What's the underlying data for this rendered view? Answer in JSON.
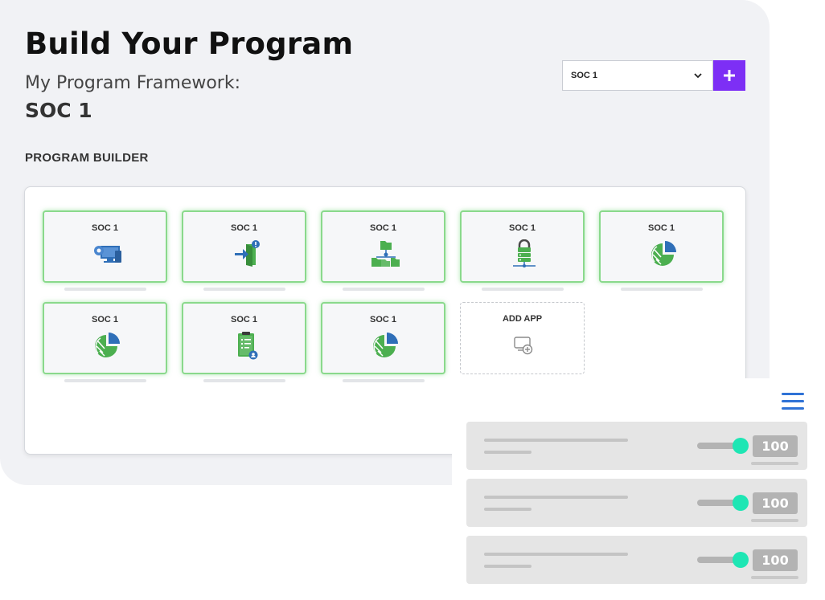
{
  "header": {
    "title": "Build Your Program",
    "framework_label": "My Program Framework:",
    "framework_value": "SOC 1"
  },
  "framework_select": {
    "selected": "SOC 1"
  },
  "builder": {
    "section_label": "PROGRAM BUILDER",
    "tiles": [
      {
        "label": "SOC 1",
        "icon": "device-settings-icon"
      },
      {
        "label": "SOC 1",
        "icon": "door-entry-alert-icon"
      },
      {
        "label": "SOC 1",
        "icon": "folder-network-icon"
      },
      {
        "label": "SOC 1",
        "icon": "server-lock-icon"
      },
      {
        "label": "SOC 1",
        "icon": "pie-chart-icon"
      },
      {
        "label": "SOC 1",
        "icon": "pie-chart-icon"
      },
      {
        "label": "SOC 1",
        "icon": "clipboard-checklist-icon"
      },
      {
        "label": "SOC 1",
        "icon": "pie-chart-icon"
      }
    ],
    "add_tile": {
      "label": "ADD APP",
      "icon": "add-app-icon"
    }
  },
  "settings": {
    "rows": [
      {
        "value": "100",
        "level": 1.0
      },
      {
        "value": "100",
        "level": 1.0
      },
      {
        "value": "100",
        "level": 1.0
      }
    ]
  },
  "colors": {
    "accent_purple": "#7d2ff5",
    "tile_glow_green": "#8ad98c",
    "icon_green": "#4caf50",
    "icon_blue": "#2f6fb8",
    "slider_thumb": "#1ee6b4",
    "menu_blue": "#2f72d6"
  }
}
